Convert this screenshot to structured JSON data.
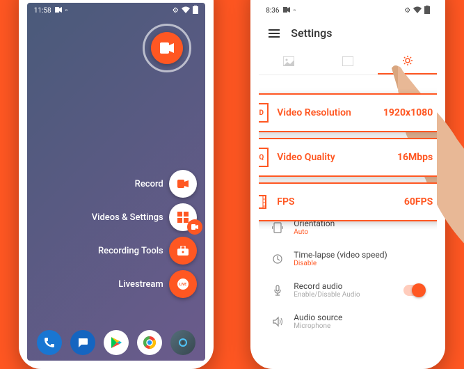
{
  "phone1": {
    "status": {
      "time": "11:58"
    },
    "fab_menu": [
      {
        "label": "Record"
      },
      {
        "label": "Videos & Settings"
      },
      {
        "label": "Recording Tools"
      },
      {
        "label": "Livestream"
      }
    ]
  },
  "phone2": {
    "status": {
      "time": "8:36"
    },
    "header": {
      "title": "Settings"
    },
    "cards": [
      {
        "icon": "HD",
        "label": "Video Resolution",
        "value": "1920x1080"
      },
      {
        "icon": "HQ",
        "label": "Video Quality",
        "value": "16Mbps"
      },
      {
        "icon": "▮▮",
        "label": "FPS",
        "value": "60FPS"
      }
    ],
    "settings": [
      {
        "title": "Orientation",
        "sub": "Auto",
        "sub_class": ""
      },
      {
        "title": "Time-lapse (video speed)",
        "sub": "Disable",
        "sub_class": ""
      },
      {
        "title": "Record audio",
        "sub": "Enable/Disable Audio",
        "sub_class": "gray",
        "toggle": true
      },
      {
        "title": "Audio source",
        "sub": "Microphone",
        "sub_class": "gray"
      }
    ]
  }
}
